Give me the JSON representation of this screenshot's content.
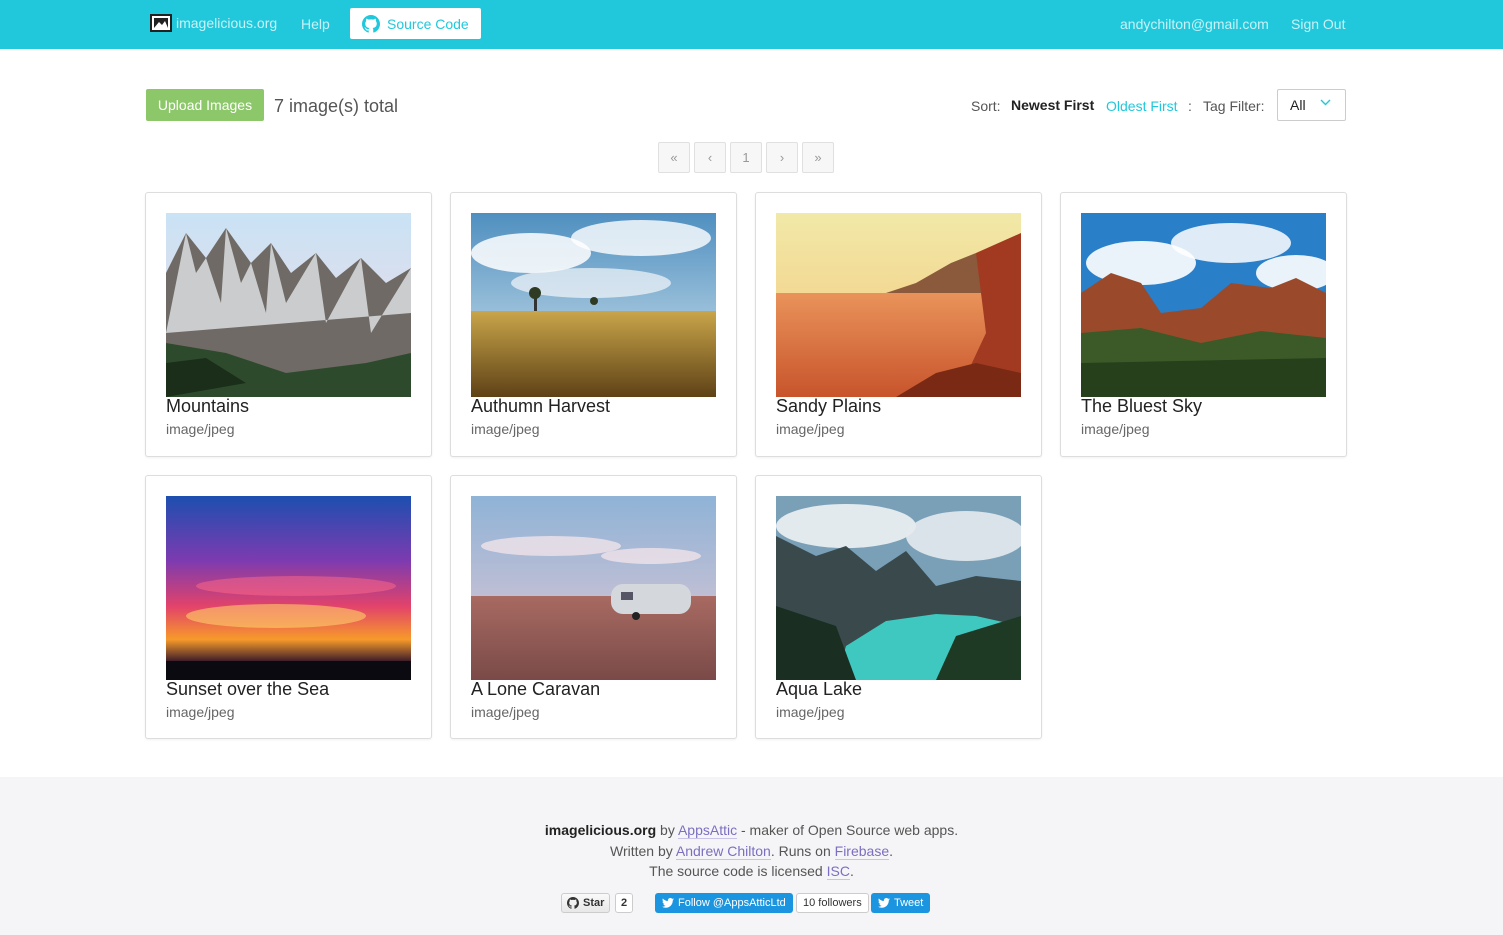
{
  "navbar": {
    "brand": "imagelicious.org",
    "help": "Help",
    "source_code": "Source Code",
    "email": "andychilton@gmail.com",
    "sign_out": "Sign Out",
    "color": "#21c8dc"
  },
  "toolbar": {
    "upload_label": "Upload Images",
    "total_text": "7 image(s) total",
    "sort_label": "Sort:",
    "sort_newest": "Newest First",
    "sort_oldest": "Oldest First",
    "sort_separator": ":",
    "tag_filter_label": "Tag Filter:",
    "tag_filter_value": "All"
  },
  "pagination": {
    "first": "«",
    "prev": "‹",
    "current": "1",
    "next": "›",
    "last": "»"
  },
  "images": [
    {
      "title": "Mountains",
      "mime": "image/jpeg",
      "scene": "mountains"
    },
    {
      "title": "Authumn Harvest",
      "mime": "image/jpeg",
      "scene": "harvest"
    },
    {
      "title": "Sandy Plains",
      "mime": "image/jpeg",
      "scene": "desert"
    },
    {
      "title": "The Bluest Sky",
      "mime": "image/jpeg",
      "scene": "canyon"
    },
    {
      "title": "Sunset over the Sea",
      "mime": "image/jpeg",
      "scene": "sunset"
    },
    {
      "title": "A Lone Caravan",
      "mime": "image/jpeg",
      "scene": "caravan"
    },
    {
      "title": "Aqua Lake",
      "mime": "image/jpeg",
      "scene": "lake"
    }
  ],
  "footer": {
    "brand": "imagelicious.org",
    "by": "by",
    "appsattic": "AppsAttic",
    "maker": "- maker of Open Source web apps.",
    "written_by": "Written by",
    "author": "Andrew Chilton",
    "runs_on": ". Runs on",
    "firebase": "Firebase",
    "period": ".",
    "licensed": "The source code is licensed",
    "isc": "ISC",
    "period2": ".",
    "star": "Star",
    "star_count": "2",
    "follow": "Follow @AppsAtticLtd",
    "followers": "10 followers",
    "tweet": "Tweet"
  }
}
